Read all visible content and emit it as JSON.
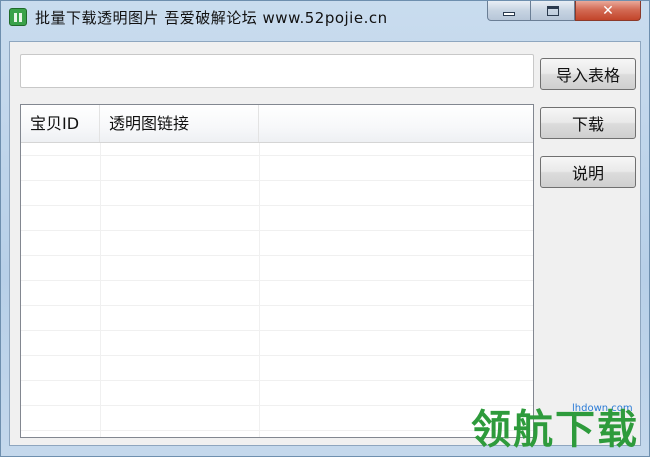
{
  "window": {
    "title": "批量下载透明图片  吾爱破解论坛  www.52pojie.cn",
    "close_glyph": "✕"
  },
  "input": {
    "value": "",
    "placeholder": ""
  },
  "buttons": {
    "import_label": "导入表格",
    "download_label": "下载",
    "help_label": "说明"
  },
  "table": {
    "columns": [
      "宝贝ID",
      "透明图链接",
      ""
    ],
    "rows": []
  },
  "watermark": {
    "site": "lhdown.com",
    "text": "领航下载"
  },
  "icons": {
    "app": "app-icon",
    "minimize": "minimize-icon",
    "maximize": "maximize-icon",
    "close": "close-icon"
  }
}
